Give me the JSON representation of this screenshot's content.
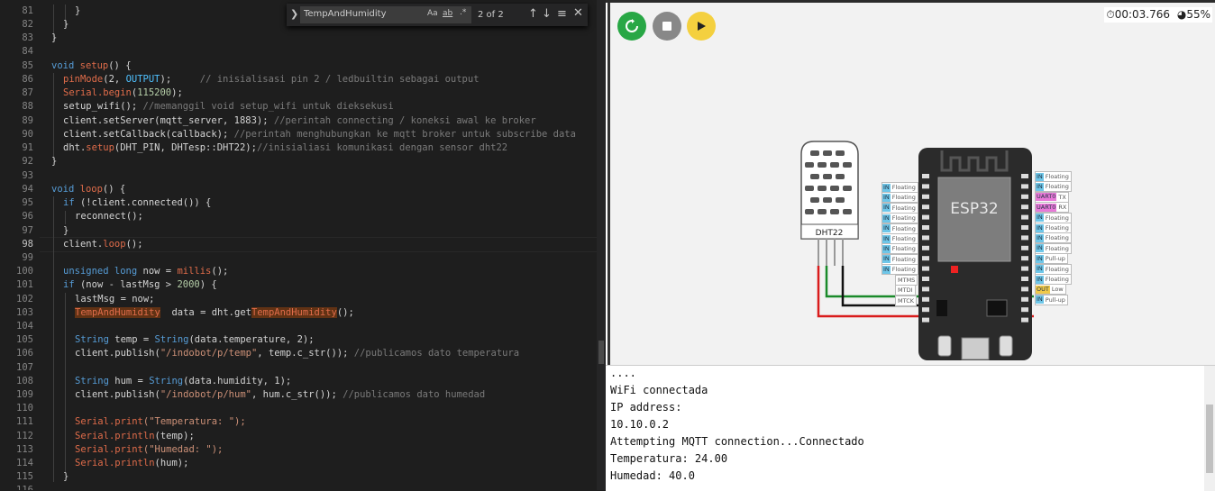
{
  "editor": {
    "line_numbers": [
      "81",
      "82",
      "83",
      "84",
      "85",
      "86",
      "87",
      "88",
      "89",
      "90",
      "91",
      "92",
      "93",
      "94",
      "95",
      "96",
      "97",
      "98",
      "99",
      "100",
      "101",
      "102",
      "103",
      "104",
      "105",
      "106",
      "107",
      "108",
      "109",
      "110",
      "111",
      "112",
      "113",
      "114",
      "115",
      "116"
    ],
    "active_line": "98",
    "lines": {
      "l81": "}",
      "l82": "}",
      "l83": "}",
      "l85_kw": "void",
      "l85_fn": "setup",
      "l85_rest": "() {",
      "l86_fn": "pinMode",
      "l86_a": "(2, ",
      "l86_const": "OUTPUT",
      "l86_b": ");",
      "l86_com": "// inisialisasi pin 2 / ledbuiltin sebagai output",
      "l87_obj": "Serial",
      "l87_fn": ".begin",
      "l87_a": "(",
      "l87_num": "115200",
      "l87_b": ");",
      "l88_a": "setup_wifi();",
      "l88_com": "//memanggil void setup_wifi untuk dieksekusi",
      "l89_a": "client.setServer(mqtt_server, 1883);",
      "l89_com": "//perintah connecting / koneksi awal ke broker",
      "l90_a": "client.setCallback(callback);",
      "l90_com": "//perintah menghubungkan ke mqtt broker untuk subscribe data",
      "l91_a": "dht.",
      "l91_fn": "setup",
      "l91_b": "(DHT_PIN, DHTesp::DHT22);",
      "l91_com": "//inisialiasi komunikasi dengan sensor dht22",
      "l92": "}",
      "l94_kw": "void",
      "l94_fn": "loop",
      "l94_rest": "() {",
      "l95_kw": "if",
      "l95_rest": "(!client.connected()) {",
      "l96": "reconnect();",
      "l97": "}",
      "l98_a": "client.",
      "l98_fn": "loop",
      "l98_b": "();",
      "l100_kw": "unsigned long",
      "l100_a": "now = ",
      "l100_fn": "millis",
      "l100_b": "();",
      "l101_kw": "if",
      "l101_a": "(now - lastMsg > ",
      "l101_num": "2000",
      "l101_b": ") {",
      "l102": "lastMsg = now;",
      "l103_hl": "TempAndHumidity",
      "l103_a": "  data = dht.get",
      "l103_hl2": "TempAndHumidity",
      "l103_b": "();",
      "l105_type": "String",
      "l105_a": "temp = ",
      "l105_type2": "String",
      "l105_b": "(data.temperature, 2);",
      "l106_a": "client.publish(",
      "l106_str": "\"/indobot/p/temp\"",
      "l106_b": ", temp.c_str());",
      "l106_com": "//publicamos dato temperatura",
      "l108_type": "String",
      "l108_a": "hum = ",
      "l108_type2": "String",
      "l108_b": "(data.humidity, 1);",
      "l109_a": "client.publish(",
      "l109_str": "\"/indobot/p/hum\"",
      "l109_b": ", hum.c_str());",
      "l109_com": "//publicamos dato humedad",
      "l111_obj": "Serial",
      "l111_fn": ".print",
      "l111_str": "(\"Temperatura: \");",
      "l112_obj": "Serial",
      "l112_fn": ".println",
      "l112_b": "(temp);",
      "l113_obj": "Serial",
      "l113_fn": ".print",
      "l113_str": "(\"Humedad: \");",
      "l114_obj": "Serial",
      "l114_fn": ".println",
      "l114_b": "(hum);",
      "l115": "}"
    }
  },
  "find": {
    "query": "TempAndHumidity",
    "opt_case": "Aa",
    "opt_word": "ab",
    "opt_regex": ".*",
    "count": "2 of 2"
  },
  "simulator": {
    "timer": "00:03.766",
    "speed": "55%",
    "dht_label": "DHT22",
    "chip_label": "ESP32",
    "left_pins": [
      "Floating",
      "Floating",
      "Floating",
      "Floating",
      "Floating",
      "Floating",
      "Floating",
      "Floating",
      "Floating"
    ],
    "left_pin_prefix": "IN",
    "left_named": [
      "MTMS",
      "MTDI",
      "MTCK"
    ],
    "right_pins": [
      {
        "tag": "IN",
        "label": "Floating"
      },
      {
        "tag": "IN",
        "label": "Floating"
      },
      {
        "tag": "UART0",
        "label": "TX"
      },
      {
        "tag": "UART0",
        "label": "RX"
      },
      {
        "tag": "IN",
        "label": "Floating"
      },
      {
        "tag": "IN",
        "label": "Floating"
      },
      {
        "tag": "IN",
        "label": "Floating"
      },
      {
        "tag": "IN",
        "label": "Floating"
      },
      {
        "tag": "IN",
        "label": "Pull-up"
      },
      {
        "tag": "IN",
        "label": "Floating"
      },
      {
        "tag": "IN",
        "label": "Floating"
      },
      {
        "tag": "OUT",
        "label": "Low"
      },
      {
        "tag": "IN",
        "label": "Pull-up"
      }
    ]
  },
  "serial": {
    "lines": [
      "....",
      "WiFi connectada",
      "IP address: ",
      "10.10.0.2",
      "Attempting MQTT connection...Connectado",
      "Temperatura: 24.00",
      "Humedad: 40.0"
    ]
  },
  "colors": {
    "accent_green": "#28a745",
    "accent_yellow": "#f4d03f",
    "pin_in": "#6ec6e8",
    "pin_uart": "#e879d8",
    "pin_out": "#f0c94a"
  }
}
